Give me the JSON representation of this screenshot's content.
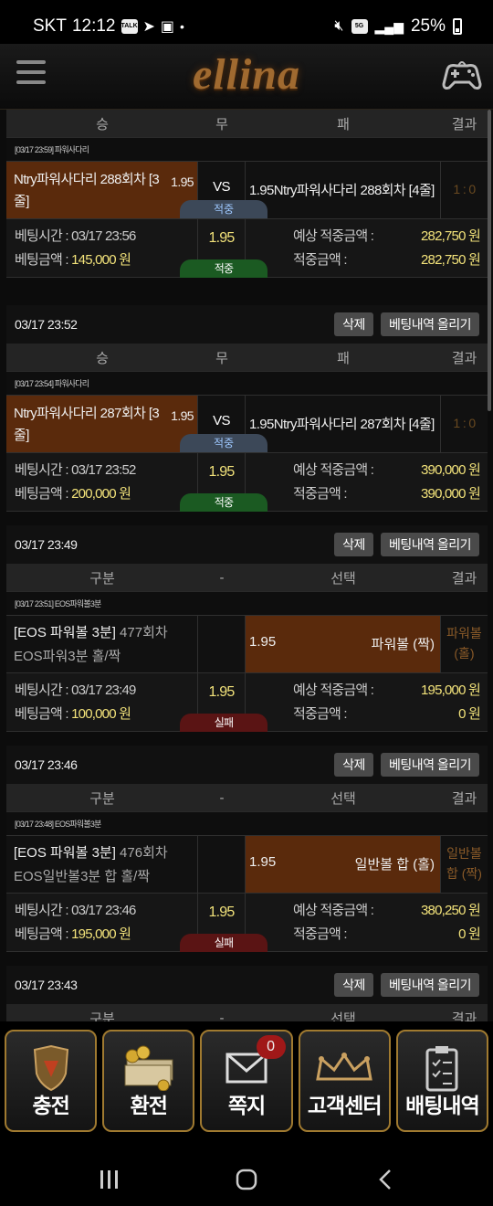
{
  "status_bar": {
    "carrier": "SKT",
    "time": "12:12",
    "network": "5G",
    "battery": "25%"
  },
  "header": {
    "logo": "ellina"
  },
  "cards": [
    {
      "id": "c1",
      "colheads": [
        "승",
        "무",
        "패",
        "결과"
      ],
      "league": "[03/17 23:59] 파워사다리",
      "home": "Ntry파워사다리 288회차 [3줄]",
      "home_odd": "1.95",
      "vs": "VS",
      "away_odd": "1.95",
      "away": "Ntry파워사다리 288회차 [4줄]",
      "result": "1 : 0",
      "status_pill": "적중",
      "bet_time_label": "베팅시간 : ",
      "bet_time": "03/17 23:56",
      "bet_amount_label": "베팅금액 : ",
      "bet_amount": "145,000 원",
      "total_odd": "1.95",
      "final_pill": "적중",
      "expected_label": "예상 적중금액 : ",
      "expected": "282,750 원",
      "win_label": "적중금액 : ",
      "win": "282,750 원"
    },
    {
      "id": "c2",
      "date": "03/17 23:52",
      "delete": "삭제",
      "upload": "베팅내역 올리기",
      "colheads": [
        "승",
        "무",
        "패",
        "결과"
      ],
      "league": "[03/17 23:54] 파워사다리",
      "home": "Ntry파워사다리 287회차 [3줄]",
      "home_odd": "1.95",
      "vs": "VS",
      "away_odd": "1.95",
      "away": "Ntry파워사다리 287회차 [4줄]",
      "result": "1 : 0",
      "status_pill": "적중",
      "bet_time_label": "베팅시간 : ",
      "bet_time": "03/17 23:52",
      "bet_amount_label": "베팅금액 : ",
      "bet_amount": "200,000 원",
      "total_odd": "1.95",
      "final_pill": "적중",
      "expected_label": "예상 적중금액 : ",
      "expected": "390,000 원",
      "win_label": "적중금액 : ",
      "win": "390,000 원"
    },
    {
      "id": "c3",
      "date": "03/17 23:49",
      "delete": "삭제",
      "upload": "베팅내역 올리기",
      "colheads": [
        "구분",
        "-",
        "선택",
        "결과"
      ],
      "league": "[03/17 23:51] EOS파워볼3분",
      "game_tag": "[EOS 파워볼 3분]",
      "game_desc": " 477회차 EOS파워3분 홀/짝",
      "sel_odd": "1.95",
      "selection": "파워볼 (짝)",
      "result": "파워볼 (홀)",
      "bet_time_label": "베팅시간 : ",
      "bet_time": "03/17 23:49",
      "bet_amount_label": "베팅금액 : ",
      "bet_amount": "100,000 원",
      "total_odd": "1.95",
      "final_pill": "실패",
      "expected_label": "예상 적중금액 : ",
      "expected": "195,000 원",
      "win_label": "적중금액 : ",
      "win": "0 원"
    },
    {
      "id": "c4",
      "date": "03/17 23:46",
      "delete": "삭제",
      "upload": "베팅내역 올리기",
      "colheads": [
        "구분",
        "-",
        "선택",
        "결과"
      ],
      "league": "[03/17 23:48] EOS파워볼3분",
      "game_tag": "[EOS 파워볼 3분]",
      "game_desc": " 476회차 EOS일반볼3분 합 홀/짝",
      "sel_odd": "1.95",
      "selection": "일반볼 합 (홀)",
      "result": "일반볼 합 (짝)",
      "bet_time_label": "베팅시간 : ",
      "bet_time": "03/17 23:46",
      "bet_amount_label": "베팅금액 : ",
      "bet_amount": "195,000 원",
      "total_odd": "1.95",
      "final_pill": "실패",
      "expected_label": "예상 적중금액 : ",
      "expected": "380,250 원",
      "win_label": "적중금액 : ",
      "win": "0 원"
    },
    {
      "id": "c5",
      "date": "03/17 23:43",
      "delete": "삭제",
      "upload": "베팅내역 올리기",
      "colheads": [
        "구분",
        "-",
        "선택",
        "결과"
      ]
    }
  ],
  "bottom_nav": [
    {
      "label": "충전",
      "icon": "shield-charge-icon"
    },
    {
      "label": "환전",
      "icon": "money-stack-icon"
    },
    {
      "label": "쪽지",
      "icon": "envelope-icon",
      "badge": "0"
    },
    {
      "label": "고객센터",
      "icon": "crown-icon"
    },
    {
      "label": "배팅내역",
      "icon": "clipboard-icon"
    }
  ],
  "colors": {
    "accent_gold": "#a07a30",
    "selected_brown": "#5a2a0c",
    "value_yellow": "#f2e27a",
    "win_green": "#1b5a22",
    "lose_red": "#5a1414"
  }
}
